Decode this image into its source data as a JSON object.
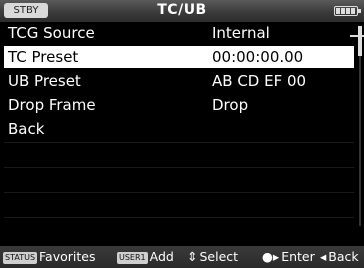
{
  "status": "STBY",
  "title": "TC/UB",
  "menu": [
    {
      "label": "TCG Source",
      "value": "Internal"
    },
    {
      "label": "TC Preset",
      "value": "00:00:00.00"
    },
    {
      "label": "UB Preset",
      "value": "AB CD EF 00"
    },
    {
      "label": "Drop Frame",
      "value": "Drop"
    },
    {
      "label": "Back",
      "value": ""
    }
  ],
  "selected_index": 1,
  "help": {
    "status_chip": "STATUS",
    "favorites": "Favorites",
    "user_chip": "USER1",
    "add": "Add",
    "select": "Select",
    "enter": "Enter",
    "back": "Back"
  },
  "icons": {
    "select": "up-down-arrow-icon",
    "enter": "dial-enter-icon",
    "back": "left-arrow-icon",
    "battery": "battery-icon"
  }
}
